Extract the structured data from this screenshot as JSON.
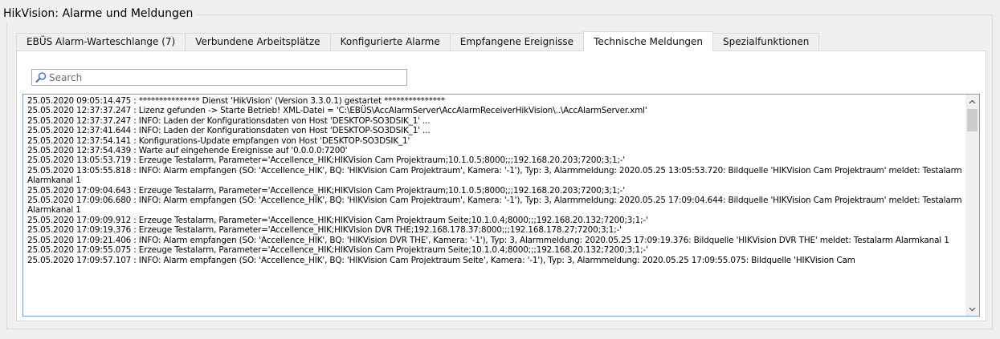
{
  "window": {
    "title": "HikVision: Alarme und Meldungen"
  },
  "tabs": [
    {
      "label": "EBÜS Alarm-Warteschlange (7)"
    },
    {
      "label": "Verbundene Arbeitsplätze"
    },
    {
      "label": "Konfigurierte Alarme"
    },
    {
      "label": "Empfangene Ereignisse"
    },
    {
      "label": "Technische Meldungen",
      "active": true
    },
    {
      "label": "Spezialfunktionen"
    }
  ],
  "search": {
    "placeholder": "Search",
    "value": ""
  },
  "log": {
    "lines": [
      "25.05.2020 09:05:14.475 : *************** Dienst 'HikVision' (Version 3.3.0.1) gestartet ***************",
      "25.05.2020 12:37:37.247 : Lizenz gefunden -> Starte Betrieb! XML-Datei = 'C:\\EBÜS\\AccAlarmServer\\AccAlarmReceiverHikVision\\..\\AccAlarmServer.xml'",
      "25.05.2020 12:37:37.247 : INFO: Laden der Konfigurationsdaten von Host 'DESKTOP-SO3DSIK_1' ...",
      "25.05.2020 12:37:41.644 : INFO: Laden der Konfigurationsdaten von Host 'DESKTOP-SO3DSIK_1' ...",
      "25.05.2020 12:37:54.141 : Konfigurations-Update empfangen von Host 'DESKTOP-SO3DSIK_1'",
      "25.05.2020 12:37:54.439 : Warte auf eingehende Ereignisse auf '0.0.0.0:7200'",
      "25.05.2020 13:05:53.719 : Erzeuge Testalarm, Parameter='Accellence_HIK;HIKVision Cam Projektraum;10.1.0.5;8000;;;192.168.20.203;7200;3;1;-'",
      "25.05.2020 13:05:55.818 : INFO: Alarm empfangen (SO: 'Accellence_HIK', BQ: 'HIKVision Cam Projektraum', Kamera: '-1'), Typ: 3, Alarmmeldung: 2020.05.25 13:05:53.720: Bildquelle 'HIKVision Cam Projektraum' meldet: Testalarm Alarmkanal 1",
      "25.05.2020 17:09:04.643 : Erzeuge Testalarm, Parameter='Accellence_HIK;HIKVision Cam Projektraum;10.1.0.5;8000;;;192.168.20.203;7200;3;1;-'",
      "25.05.2020 17:09:06.680 : INFO: Alarm empfangen (SO: 'Accellence_HIK', BQ: 'HIKVision Cam Projektraum', Kamera: '-1'), Typ: 3, Alarmmeldung: 2020.05.25 17:09:04.644: Bildquelle 'HIKVision Cam Projektraum' meldet: Testalarm Alarmkanal 1",
      "25.05.2020 17:09:09.912 : Erzeuge Testalarm, Parameter='Accellence_HIK;HIKVision Cam Projektraum Seite;10.1.0.4;8000;;;192.168.20.132;7200;3;1;-'",
      "25.05.2020 17:09:19.376 : Erzeuge Testalarm, Parameter='Accellence_HIK;HIKVision DVR THE;192.168.178.37;8000;;;192.168.178.27;7200;3;1;-'",
      "25.05.2020 17:09:21.406 : INFO: Alarm empfangen (SO: 'Accellence_HIK', BQ: 'HIKVision DVR THE', Kamera: '-1'), Typ: 3, Alarmmeldung: 2020.05.25 17:09:19.376: Bildquelle 'HIKVision DVR THE' meldet: Testalarm Alarmkanal 1",
      "25.05.2020 17:09:55.075 : Erzeuge Testalarm, Parameter='Accellence_HIK;HIKVision Cam Projektraum Seite;10.1.0.4;8000;;;192.168.20.132;7200;3;1;-'",
      "25.05.2020 17:09:57.107 : INFO: Alarm empfangen (SO: 'Accellence_HIK', BQ: 'HIKVision Cam Projektraum Seite', Kamera: '-1'), Typ: 3, Alarmmeldung: 2020.05.25 17:09:55.075: Bildquelle 'HIKVision Cam"
    ]
  },
  "colors": {
    "background": "#f0f0f0",
    "log_border": "#7a9fd6",
    "search_icon": "#4a78c2"
  },
  "icons": {
    "search": "search-icon",
    "scroll_up": "chevron-up-icon",
    "scroll_down": "chevron-down-icon"
  }
}
